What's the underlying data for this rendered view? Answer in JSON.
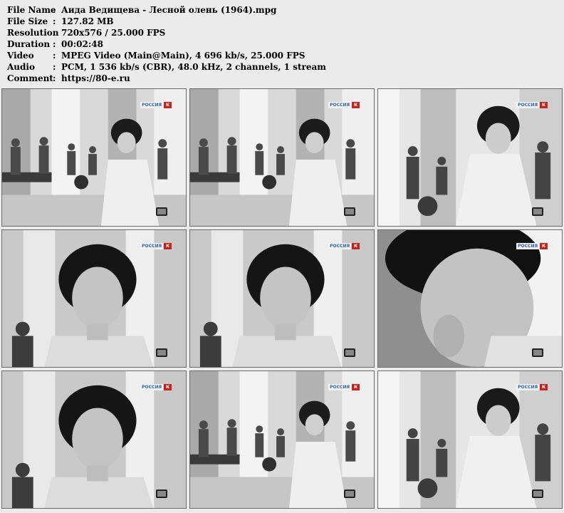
{
  "info": {
    "rows": [
      {
        "label": "File Name",
        "value": "Аида Ведищева - Лесной олень (1964).mpg"
      },
      {
        "label": "File Size",
        "value": "127.82 MB"
      },
      {
        "label": "Resolution",
        "value": "720x576 / 25.000 FPS"
      },
      {
        "label": "Duration",
        "value": "00:02:48"
      },
      {
        "label": "Video",
        "value": "MPEG Video (Main@Main), 4 696 kb/s, 25.000 FPS"
      },
      {
        "label": "Audio",
        "value": "PCM, 1 536 kb/s (CBR), 48.0 kHz, 2 channels, 1 stream"
      },
      {
        "label": "Comment",
        "value": "https://80-e.ru"
      }
    ],
    "separator": ":"
  },
  "thumbnails": {
    "logo_word": "РОССИЯ",
    "logo_mark": "К",
    "frames": [
      {
        "shot": "wide"
      },
      {
        "shot": "wide"
      },
      {
        "shot": "medium"
      },
      {
        "shot": "close"
      },
      {
        "shot": "close"
      },
      {
        "shot": "extreme-close"
      },
      {
        "shot": "close"
      },
      {
        "shot": "wide"
      },
      {
        "shot": "medium"
      }
    ]
  }
}
